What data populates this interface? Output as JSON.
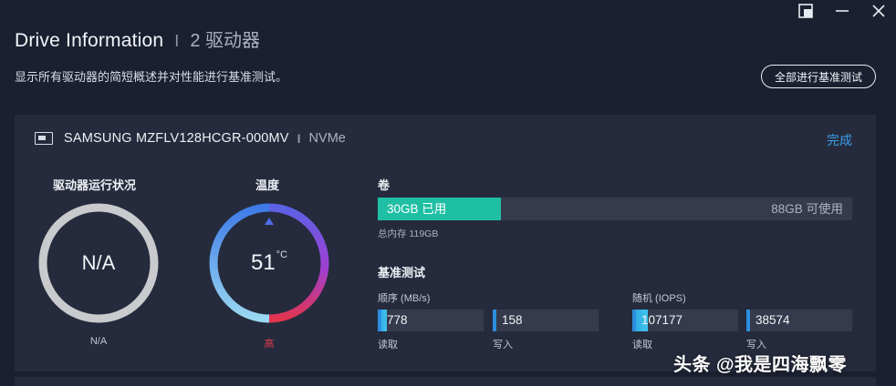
{
  "window": {
    "controls": [
      "restore-icon",
      "minimize-icon",
      "close-icon"
    ]
  },
  "header": {
    "title": "Drive Information",
    "separator": "I",
    "drive_count": "2 驱动器",
    "subtitle": "显示所有驱动器的简短概述并对性能进行基准测试。",
    "bench_all_button": "全部进行基准测试"
  },
  "drive": {
    "name": "SAMSUNG MZFLV128HCGR-000MV",
    "separator": "I",
    "interface": "NVMe",
    "status_link": "完成",
    "health": {
      "label": "驱动器运行状况",
      "value": "N/A",
      "caption": "N/A",
      "ring_color": "#c9cacd"
    },
    "temperature": {
      "label": "温度",
      "value": "51",
      "unit": "°C",
      "caption": "高",
      "caption_color": "#e23a4e"
    },
    "volume": {
      "label": "卷",
      "used_label": "30GB 已用",
      "free_label": "88GB 可使用",
      "used_fraction": 0.26,
      "total_label": "总内存 119GB",
      "used_color": "#1fbfa4"
    },
    "benchmark": {
      "label": "基准测试",
      "sequential": {
        "label": "顺序 (MB/s)",
        "read": {
          "value": "778",
          "caption": "读取",
          "fill_fraction": 0.09
        },
        "write": {
          "value": "158",
          "caption": "写入",
          "fill_fraction": 0.0
        }
      },
      "random": {
        "label": "随机 (IOPS)",
        "read": {
          "value": "107177",
          "caption": "读取",
          "fill_fraction": 0.15
        },
        "write": {
          "value": "38574",
          "caption": "写入",
          "fill_fraction": 0.0
        }
      }
    }
  },
  "watermark": "头条 @我是四海飘零"
}
